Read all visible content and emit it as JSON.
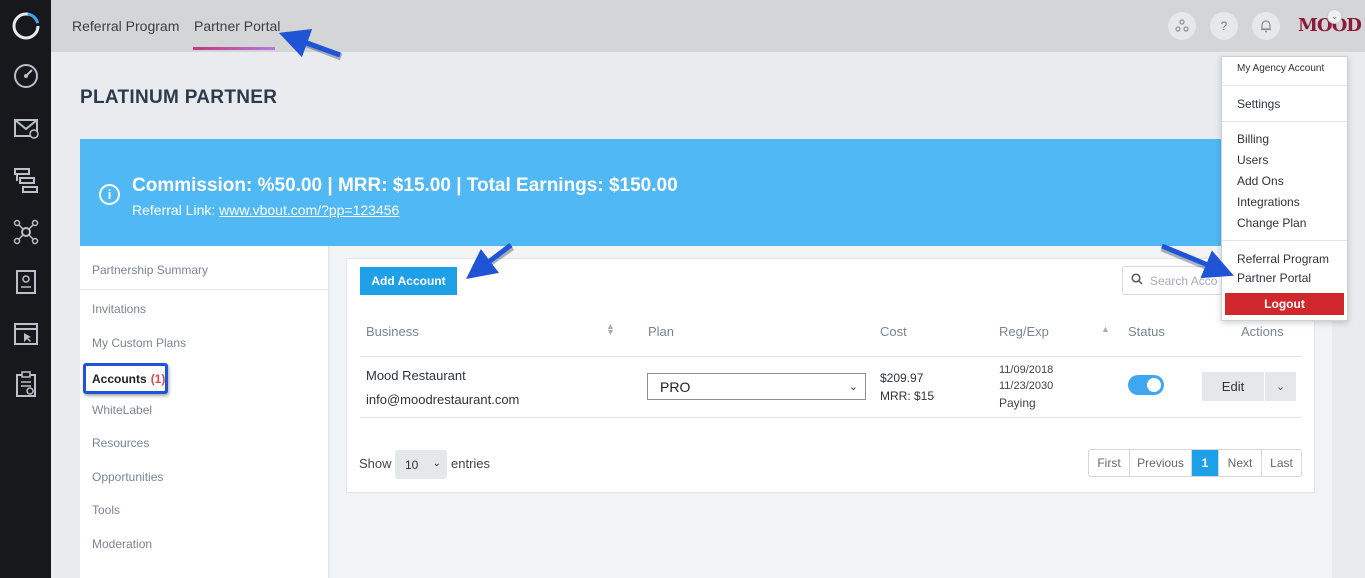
{
  "topbar": {
    "tabs": [
      {
        "label": "Referral Program"
      },
      {
        "label": "Partner Portal",
        "active": true
      }
    ],
    "help_glyph": "?",
    "logo_text": "MOOD",
    "accent_color": "#1ea0e8"
  },
  "page": {
    "title": "PLATINUM PARTNER"
  },
  "banner": {
    "headline": "Commission: %50.00 | MRR: $15.00 | Total Earnings: $150.00",
    "link_prefix": "Referral Link: ",
    "link_text": "www.vbout.com/?pp=123456",
    "color": "#50b9f5"
  },
  "sidenav": {
    "items": [
      {
        "label": "Partnership Summary"
      },
      {
        "label": "Invitations"
      },
      {
        "label": "My Custom Plans"
      },
      {
        "label": "Accounts",
        "count": "(1)",
        "active": true
      },
      {
        "label": "WhiteLabel"
      },
      {
        "label": "Resources"
      },
      {
        "label": "Opportunities"
      },
      {
        "label": "Tools"
      },
      {
        "label": "Moderation"
      }
    ]
  },
  "toolbar": {
    "add_account_label": "Add Account",
    "search_placeholder": "Search Acco"
  },
  "table": {
    "headers": [
      "Business",
      "Plan",
      "Cost",
      "Reg/Exp",
      "Status",
      "Actions"
    ],
    "rows": [
      {
        "business_name": "Mood Restaurant",
        "business_email": "info@moodrestaurant.com",
        "plan": "PRO",
        "cost": "$209.97",
        "mrr": "MRR: $15",
        "reg": "11/09/2018",
        "exp": "11/23/2030",
        "state": "Paying",
        "status_on": true,
        "edit_label": "Edit"
      }
    ]
  },
  "footer": {
    "show_label": "Show",
    "entries_value": "10",
    "entries_label": "entries",
    "pager": [
      "First",
      "Previous",
      "1",
      "Next",
      "Last"
    ]
  },
  "user_menu": {
    "header": "My Agency Account",
    "items_1": [
      "Settings"
    ],
    "items_2": [
      "Billing",
      "Users",
      "Add Ons",
      "Integrations",
      "Change Plan"
    ],
    "items_3": [
      "Referral Program",
      "Partner Portal"
    ],
    "logout_label": "Logout"
  }
}
